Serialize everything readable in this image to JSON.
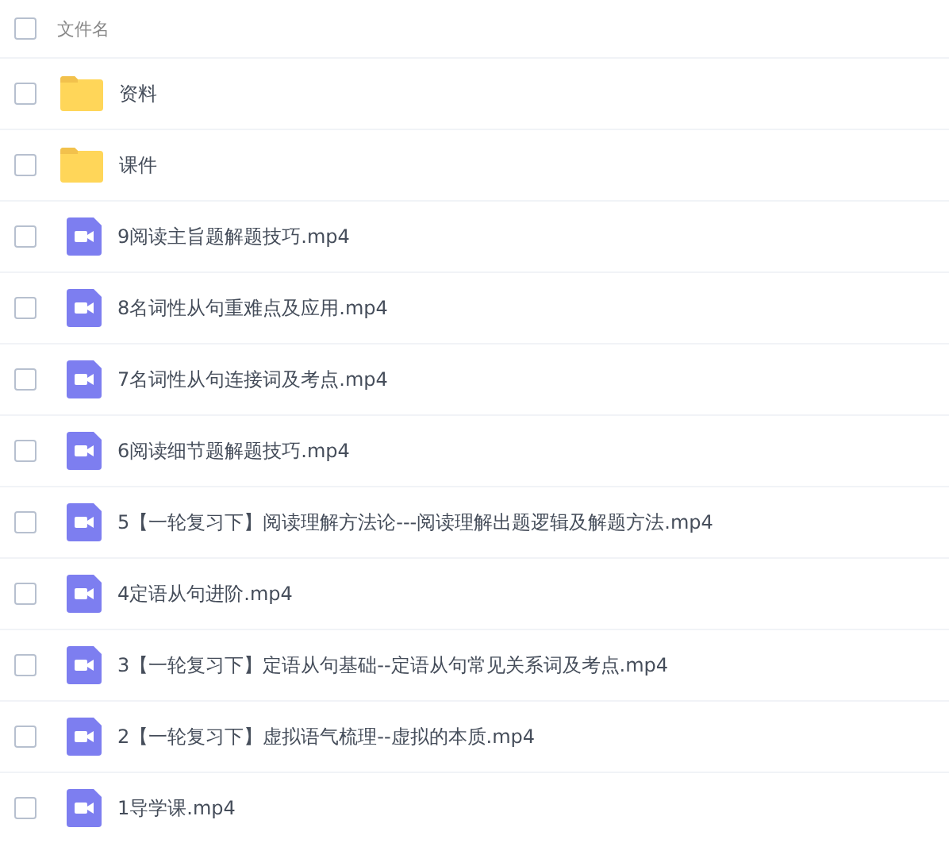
{
  "header": {
    "label": "文件名",
    "checked": false
  },
  "files": [
    {
      "kind": "folder",
      "name": "资料",
      "checked": false
    },
    {
      "kind": "folder",
      "name": "课件",
      "checked": false
    },
    {
      "kind": "video",
      "name": "9阅读主旨题解题技巧.mp4",
      "checked": false
    },
    {
      "kind": "video",
      "name": "8名词性从句重难点及应用.mp4",
      "checked": false
    },
    {
      "kind": "video",
      "name": "7名词性从句连接词及考点.mp4",
      "checked": false
    },
    {
      "kind": "video",
      "name": "6阅读细节题解题技巧.mp4",
      "checked": false
    },
    {
      "kind": "video",
      "name": "5【一轮复习下】阅读理解方法论---阅读理解出题逻辑及解题方法.mp4",
      "checked": false
    },
    {
      "kind": "video",
      "name": "4定语从句进阶.mp4",
      "checked": false
    },
    {
      "kind": "video",
      "name": "3【一轮复习下】定语从句基础--定语从句常见关系词及考点.mp4",
      "checked": false
    },
    {
      "kind": "video",
      "name": "2【一轮复习下】虚拟语气梳理--虚拟的本质.mp4",
      "checked": false
    },
    {
      "kind": "video",
      "name": "1导学课.mp4",
      "checked": false
    }
  ]
}
